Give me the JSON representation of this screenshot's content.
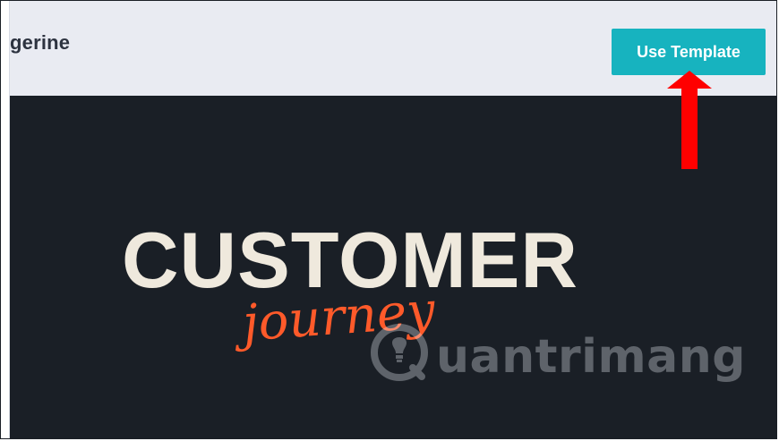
{
  "header": {
    "title": "gerine",
    "use_template_label": "Use Template"
  },
  "preview": {
    "title_main": "CUSTOMER",
    "title_script": "journey",
    "watermark_text": "uantrimang",
    "watermark_icon": "lightbulb-q-icon"
  },
  "annotation": {
    "arrow_icon": "arrow-up-icon",
    "arrow_color": "#ff0000"
  },
  "colors": {
    "header_bg": "#e9ebf2",
    "button_bg": "#17b3bf",
    "preview_bg": "#1a1f26",
    "title_main": "#efe9dd",
    "title_script": "#ff5a2a"
  }
}
